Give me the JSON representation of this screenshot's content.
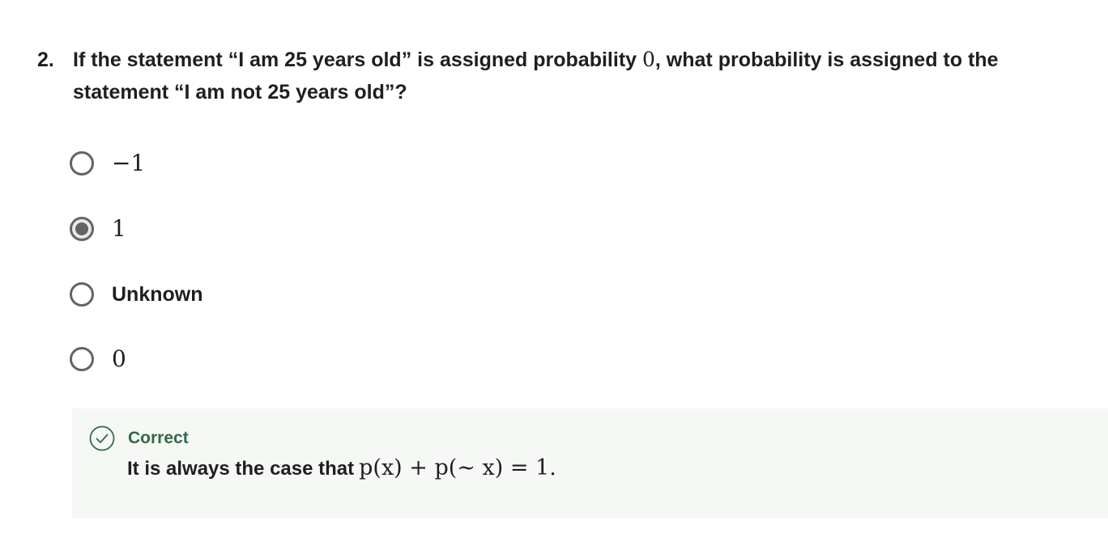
{
  "question": {
    "number": "2.",
    "text_before_math": "If the statement “I am 25 years old” is assigned probability ",
    "math_value": "0",
    "text_after_math": ", what probability is assigned to the statement “I am not 25 years old”?"
  },
  "options": [
    {
      "label": "−1",
      "selected": false
    },
    {
      "label": "1",
      "selected": true
    },
    {
      "label": "Unknown",
      "selected": false
    },
    {
      "label": "0",
      "selected": false
    }
  ],
  "feedback": {
    "status": "Correct",
    "text": "It is always the case that",
    "formula": "p(x) + p(∼ x) = 1.",
    "accent_color": "#2f6b46",
    "background_color": "#f6f8f6"
  },
  "icons": {
    "feedback": "check-circle-icon",
    "option_unselected": "radio-empty-icon",
    "option_selected": "radio-filled-icon"
  }
}
